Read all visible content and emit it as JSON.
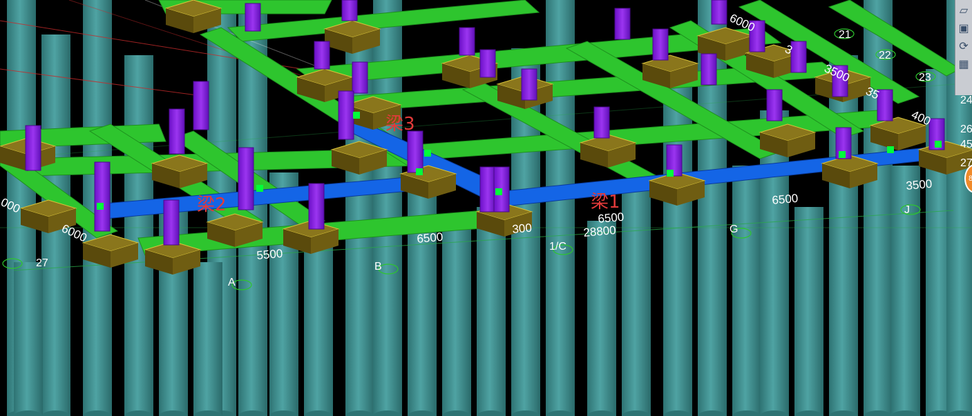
{
  "beam_labels": {
    "beam1": "梁1",
    "beam2": "梁2",
    "beam3": "梁3"
  },
  "dimensions": {
    "d6000_top": "6000",
    "d3_top": "3",
    "d3500_a": "3500",
    "d3500_b": "3500",
    "d35": "35",
    "d400": "400",
    "d6000_left": "6000",
    "d5500": "5500",
    "d6500_a": "6500",
    "d300": "300",
    "d6500_b": "6500",
    "d28800": "28800",
    "d6500_c": "6500",
    "d3500_c": "3500",
    "d000_left": "000"
  },
  "axis_labels": {
    "a21": "21",
    "a22": "22",
    "a23": "23",
    "a24": "24",
    "a26": "26",
    "a45": "45",
    "a27r": "27",
    "a27": "27",
    "aA": "A",
    "aB": "B",
    "a1C": "1/C",
    "aG": "G",
    "aJ": "J"
  },
  "toolbar": {
    "buttons": [
      {
        "icon": "cube-view-icon",
        "glyph": "▱"
      },
      {
        "icon": "box-view-icon",
        "glyph": "▣"
      },
      {
        "icon": "orbit-icon",
        "glyph": "⟳"
      },
      {
        "icon": "grid-view-icon",
        "glyph": "▦"
      }
    ]
  },
  "nav_wheel": {
    "label": "8"
  },
  "colors": {
    "background": "#000000",
    "pile": "#3c8f8f",
    "beam_green": "#2ec52e",
    "beam_selected": "#1465e6",
    "column": "#8a22e0",
    "pile_cap": "#6b5a12",
    "grip": "#00ff3a",
    "beam_label": "#e23a3a"
  }
}
